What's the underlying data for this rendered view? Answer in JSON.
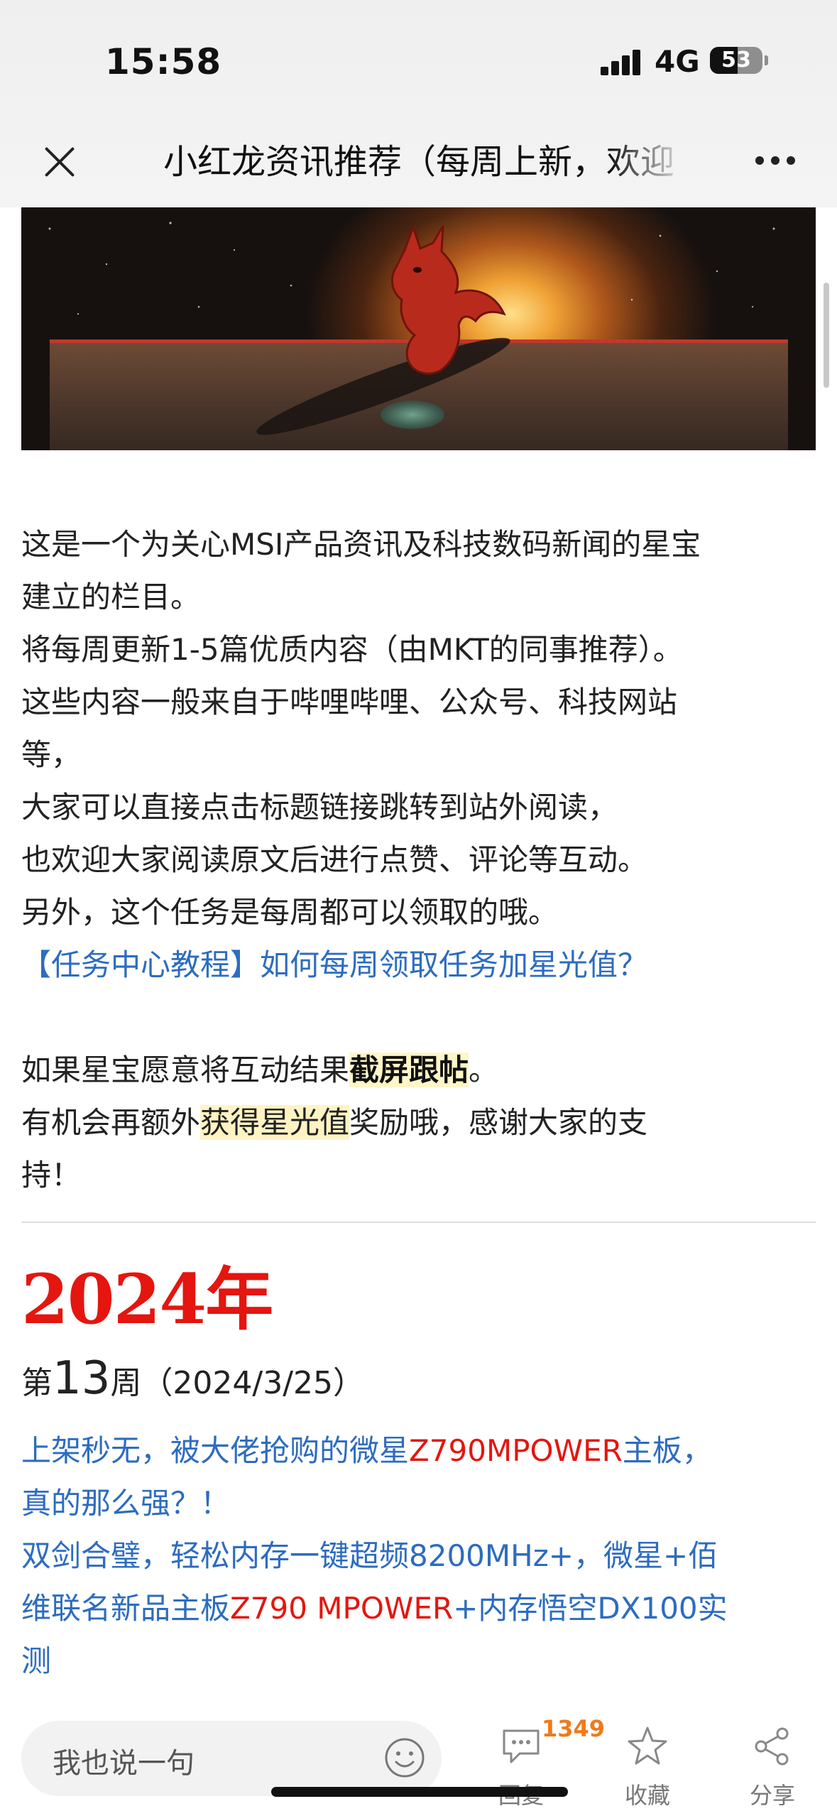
{
  "status_bar": {
    "time": "15:58",
    "network": "4G",
    "battery": "53",
    "battery_level": 0.53
  },
  "header": {
    "title": "小红龙资讯推荐（每周上新，欢迎"
  },
  "intro": {
    "lines": [
      "这是一个为关心MSI产品资讯及科技数码新闻的星宝",
      "建立的栏目。",
      "将每周更新1-5篇优质内容（由MKT的同事推荐）。",
      "这些内容一般来自于哔哩哔哩、公众号、科技网站",
      "等，",
      "大家可以直接点击标题链接跳转到站外阅读，",
      "也欢迎大家阅读原文后进行点赞、评论等互动。",
      "另外，这个任务是每周都可以领取的哦。"
    ],
    "tutorial_link": "【任务中心教程】如何每周领取任务加星光值？",
    "screenshot_line": {
      "before": "如果星宝愿意将互动结果",
      "bold": "截屏跟帖",
      "after": "。"
    },
    "reward_line": {
      "before": "有机会再额外",
      "highlight": "获得星光值",
      "after": "奖励哦，感谢大家的支"
    },
    "reward_line_end": "持！"
  },
  "year_heading": "2024年",
  "week": {
    "prefix": "第",
    "number": "13",
    "suffix": "周（2024/3/25）"
  },
  "articles": [
    {
      "l1a": "上架秒无，被大佬抢购的微星",
      "l1red": "Z790MPOWER",
      "l1b": "主板，",
      "l2": "真的那么强？！"
    },
    {
      "l1": "双剑合璧，轻松内存一键超频8200MHz+，微星+佰",
      "l2a": "维联名新品主板",
      "l2red": "Z790 MPOWER",
      "l2b": "+内存悟空DX100实",
      "l3": "测"
    }
  ],
  "bottom_bar": {
    "input_placeholder": "我也说一句",
    "reply_count": "1349",
    "reply_label": "回复",
    "favorite_label": "收藏",
    "share_label": "分享"
  },
  "colors": {
    "link": "#2d6cc0",
    "accent_red": "#e4160f",
    "badge": "#f07a1a"
  }
}
